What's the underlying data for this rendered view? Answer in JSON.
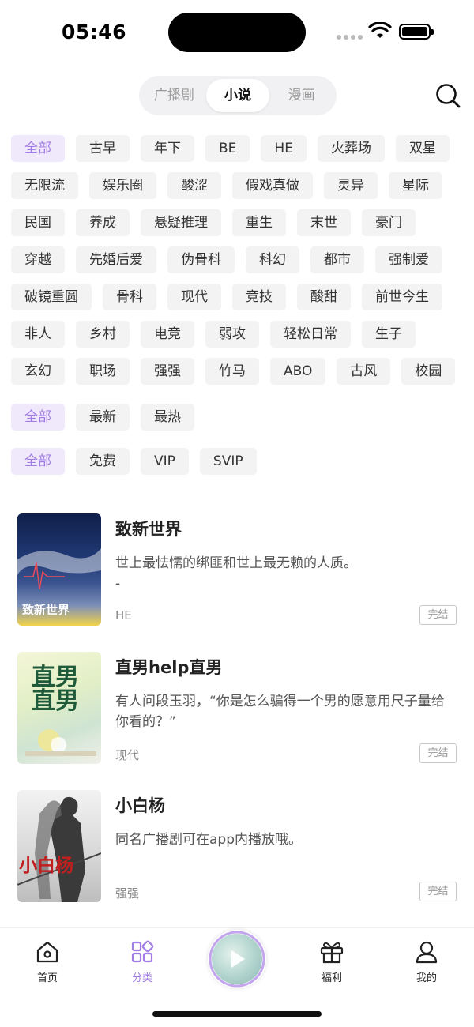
{
  "status_bar": {
    "time": "05:46",
    "icons": [
      "signal-icon",
      "wifi-icon",
      "battery-icon"
    ]
  },
  "segmented": {
    "tabs": [
      "广播剧",
      "小说",
      "漫画"
    ],
    "active": "小说"
  },
  "search_icon": "search-icon",
  "filters": {
    "genres": [
      "全部",
      "古早",
      "年下",
      "BE",
      "HE",
      "火葬场",
      "双星",
      "无限流",
      "娱乐圈",
      "酸涩",
      "假戏真做",
      "灵异",
      "星际",
      "民国",
      "养成",
      "悬疑推理",
      "重生",
      "末世",
      "豪门",
      "穿越",
      "先婚后爱",
      "伪骨科",
      "科幻",
      "都市",
      "强制爱",
      "破镜重圆",
      "骨科",
      "现代",
      "竞技",
      "酸甜",
      "前世今生",
      "非人",
      "乡村",
      "电竞",
      "弱攻",
      "轻松日常",
      "生子",
      "玄幻",
      "职场",
      "强强",
      "竹马",
      "ABO",
      "古风",
      "校园"
    ],
    "sorts": [
      "全部",
      "最新",
      "最热"
    ],
    "prices": [
      "全部",
      "免费",
      "VIP",
      "SVIP"
    ]
  },
  "books": [
    {
      "title": "致新世界",
      "desc": "世上最怯懦的绑匪和世上最无赖的人质。\n-",
      "tag": "HE",
      "status": "完结",
      "cover_text": "致新世界"
    },
    {
      "title": "直男help直男",
      "desc": "有人问段玉羽，“你是怎么骗得一个男的愿意用尺子量给你看的？”",
      "tag": "现代",
      "status": "完结",
      "cover_text": "直男直男"
    },
    {
      "title": "小白杨",
      "desc": "同名广播剧可在app内播放哦。",
      "tag": "强强",
      "status": "完结",
      "cover_text": "小白杨"
    }
  ],
  "bottom_nav": [
    {
      "label": "首页",
      "icon": "home-icon"
    },
    {
      "label": "分类",
      "icon": "category-icon",
      "active": true
    },
    {
      "label": "",
      "icon": "play-icon"
    },
    {
      "label": "福利",
      "icon": "gift-icon"
    },
    {
      "label": "我的",
      "icon": "profile-icon"
    }
  ],
  "colors": {
    "accent": "#a27de3",
    "accent_bg": "#f0e9fb",
    "chip_bg": "#f3f3f4"
  }
}
